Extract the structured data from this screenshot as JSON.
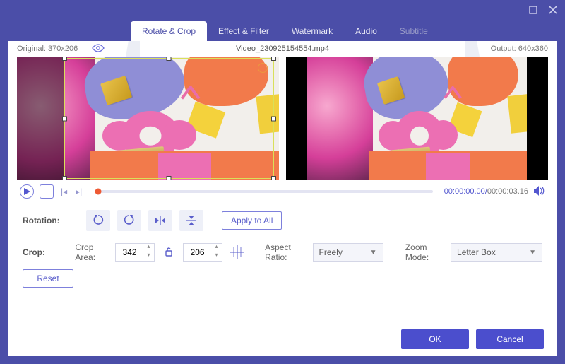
{
  "titlebar": {},
  "tabs": [
    {
      "label": "Rotate & Crop",
      "active": true
    },
    {
      "label": "Effect & Filter"
    },
    {
      "label": "Watermark"
    },
    {
      "label": "Audio"
    },
    {
      "label": "Subtitle",
      "disabled": true
    }
  ],
  "info": {
    "original_label": "Original:",
    "original_dims": "370x206",
    "filename": "Video_230925154554.mp4",
    "output_label": "Output:",
    "output_dims": "640x360"
  },
  "playback": {
    "current": "00:00:00.00",
    "duration": "00:00:03.16"
  },
  "rotation": {
    "label": "Rotation:",
    "apply_all": "Apply to All"
  },
  "crop": {
    "label": "Crop:",
    "area_label": "Crop Area:",
    "width": "342",
    "height": "206",
    "aspect_label": "Aspect Ratio:",
    "aspect_value": "Freely",
    "zoom_label": "Zoom Mode:",
    "zoom_value": "Letter Box",
    "reset": "Reset"
  },
  "footer": {
    "ok": "OK",
    "cancel": "Cancel"
  }
}
